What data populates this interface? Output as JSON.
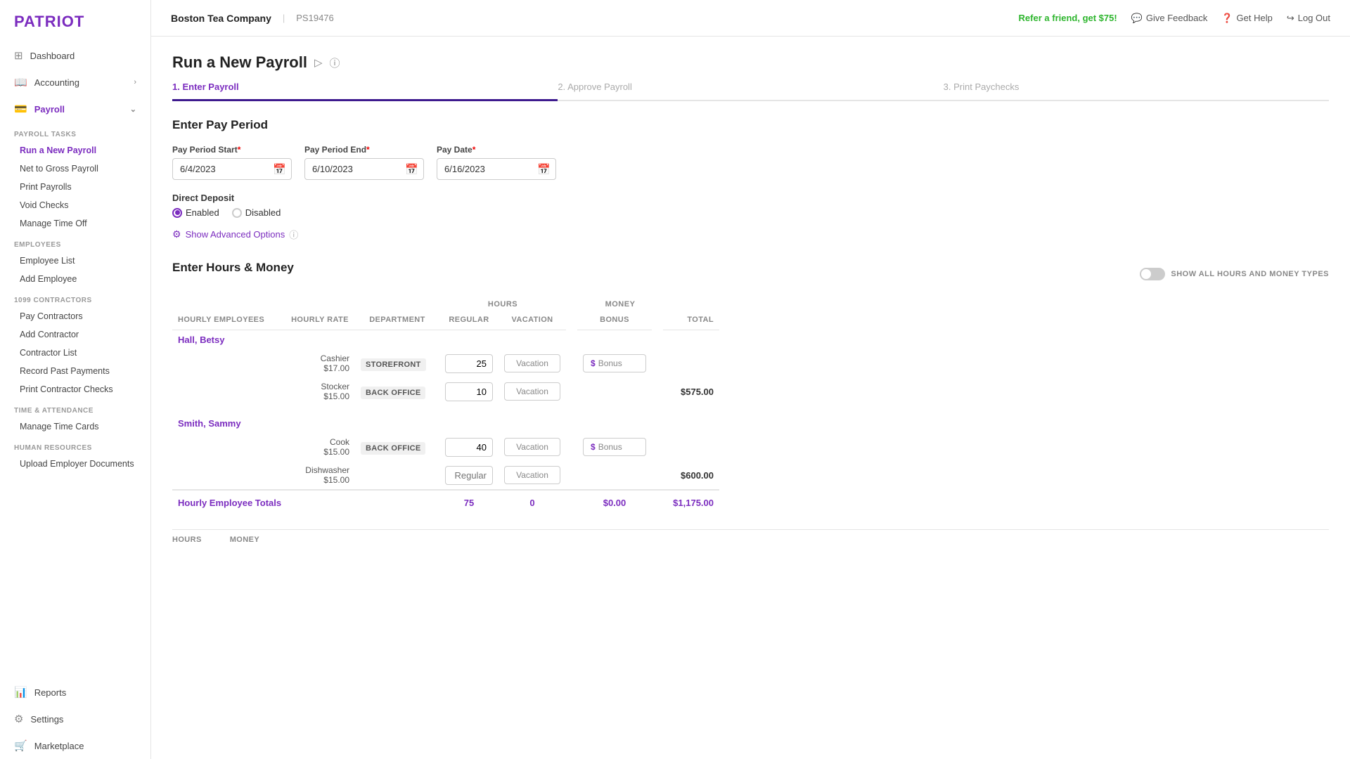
{
  "logo": "PATRIOT",
  "topbar": {
    "company": "Boston Tea Company",
    "id": "PS19476",
    "refer": "Refer a friend, get $75!",
    "feedback": "Give Feedback",
    "help": "Get Help",
    "logout": "Log Out"
  },
  "sidebar": {
    "nav": [
      {
        "id": "dashboard",
        "icon": "⊞",
        "label": "Dashboard"
      },
      {
        "id": "accounting",
        "icon": "📖",
        "label": "Accounting",
        "arrow": true
      },
      {
        "id": "payroll",
        "icon": "💳",
        "label": "Payroll",
        "arrow": true,
        "active": true
      }
    ],
    "payroll_tasks_label": "PAYROLL TASKS",
    "payroll_tasks": [
      {
        "id": "run-payroll",
        "label": "Run a New Payroll",
        "active": true
      },
      {
        "id": "net-to-gross",
        "label": "Net to Gross Payroll"
      },
      {
        "id": "print-payrolls",
        "label": "Print Payrolls"
      },
      {
        "id": "void-checks",
        "label": "Void Checks"
      },
      {
        "id": "manage-time-off",
        "label": "Manage Time Off"
      }
    ],
    "employees_label": "EMPLOYEES",
    "employees": [
      {
        "id": "employee-list",
        "label": "Employee List"
      },
      {
        "id": "add-employee",
        "label": "Add Employee"
      }
    ],
    "contractors_label": "1099 CONTRACTORS",
    "contractors": [
      {
        "id": "pay-contractors",
        "label": "Pay Contractors"
      },
      {
        "id": "add-contractor",
        "label": "Add Contractor"
      },
      {
        "id": "contractor-list",
        "label": "Contractor List"
      },
      {
        "id": "record-past-payments",
        "label": "Record Past Payments"
      },
      {
        "id": "print-contractor-checks",
        "label": "Print Contractor Checks"
      }
    ],
    "time_attendance_label": "TIME & ATTENDANCE",
    "time_attendance": [
      {
        "id": "manage-time-cards",
        "label": "Manage Time Cards"
      }
    ],
    "human_resources_label": "HUMAN RESOURCES",
    "human_resources": [
      {
        "id": "upload-docs",
        "label": "Upload Employer Documents"
      }
    ],
    "bottom_nav": [
      {
        "id": "reports",
        "icon": "📊",
        "label": "Reports"
      },
      {
        "id": "settings",
        "icon": "⚙",
        "label": "Settings"
      },
      {
        "id": "marketplace",
        "icon": "🛒",
        "label": "Marketplace"
      }
    ]
  },
  "page": {
    "title": "Run a New Payroll",
    "steps": [
      {
        "id": "step1",
        "label": "1. Enter Payroll",
        "active": true
      },
      {
        "id": "step2",
        "label": "2. Approve Payroll",
        "active": false
      },
      {
        "id": "step3",
        "label": "3. Print Paychecks",
        "active": false
      }
    ]
  },
  "pay_period": {
    "title": "Enter Pay Period",
    "start_label": "Pay Period Start",
    "start_value": "6/4/2023",
    "end_label": "Pay Period End",
    "end_value": "6/10/2023",
    "pay_date_label": "Pay Date",
    "pay_date_value": "6/16/2023",
    "direct_deposit_label": "Direct Deposit",
    "enabled_label": "Enabled",
    "disabled_label": "Disabled",
    "show_advanced": "Show Advanced Options"
  },
  "hours_money": {
    "title": "Enter Hours & Money",
    "toggle_label": "SHOW ALL HOURS AND MONEY TYPES",
    "col_hours": "HOURS",
    "col_money": "MONEY",
    "headers": {
      "employee": "Hourly Employees",
      "rate": "Hourly Rate",
      "department": "Department",
      "regular": "Regular",
      "vacation": "Vacation",
      "bonus": "Bonus",
      "total": "Total"
    },
    "employees": [
      {
        "name": "Hall, Betsy",
        "rows": [
          {
            "role": "Cashier",
            "rate": "$17.00",
            "department": "STOREFRONT",
            "regular": "25",
            "vacation_placeholder": "Vacation",
            "bonus_placeholder": "Bonus",
            "total": ""
          },
          {
            "role": "Stocker",
            "rate": "$15.00",
            "department": "BACK OFFICE",
            "regular": "10",
            "vacation_placeholder": "Vacation",
            "bonus_placeholder": "",
            "total": "$575.00"
          }
        ]
      },
      {
        "name": "Smith, Sammy",
        "rows": [
          {
            "role": "Cook",
            "rate": "$15.00",
            "department": "BACK OFFICE",
            "regular": "40",
            "vacation_placeholder": "Vacation",
            "bonus_placeholder": "Bonus",
            "total": ""
          },
          {
            "role": "Dishwasher",
            "rate": "$15.00",
            "department": "",
            "regular_placeholder": "Regular",
            "vacation_placeholder": "Vacation",
            "bonus_placeholder": "",
            "total": "$600.00"
          }
        ]
      }
    ],
    "totals": {
      "label": "Hourly Employee Totals",
      "regular": "75",
      "vacation": "0",
      "bonus": "$0.00",
      "total": "$1,175.00"
    },
    "bottom_hours_label": "HOURS",
    "bottom_money_label": "MONEY"
  }
}
